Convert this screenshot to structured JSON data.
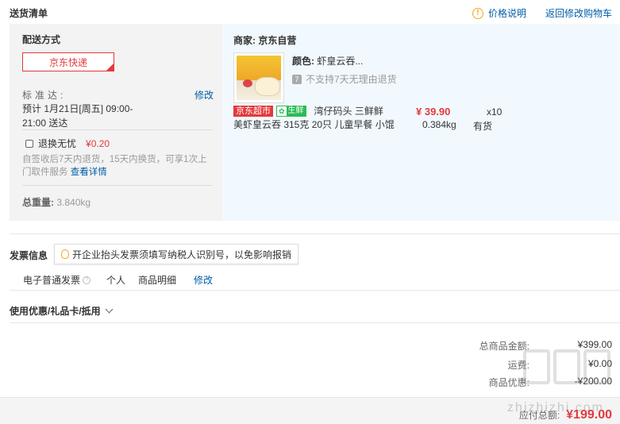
{
  "header": {
    "title": "送货清单",
    "price_note": "价格说明",
    "price_note_icon": "warning-icon",
    "back_to_cart": "返回修改购物车"
  },
  "delivery": {
    "label": "配送方式",
    "express": "京东快递",
    "standard_label": "标准达:",
    "modify": "修改",
    "estimate": "预计 1月21日[周五] 09:00-21:00 送达",
    "exchange_label": "退换无忧",
    "exchange_price": "¥0.20",
    "exchange_desc": "自签收后7天内退货，15天内换货，可享1次上门取件服务",
    "exchange_detail_link": "查看详情",
    "weight_label": "总重量:",
    "weight_value": "3.840kg"
  },
  "item": {
    "seller": "商家: 京东自营",
    "color_label": "颜色:",
    "color_value": "虾皇云吞...",
    "no_return": "不支持7天无理由退货",
    "badge_jd": "京东超市",
    "badge_fresh": "生鲜",
    "title_line1": "湾仔码头 三鲜鲜",
    "title_line2": "美虾皇云吞 315克 20只 儿童早餐 小馄",
    "price": "¥ 39.90",
    "qty": "x10",
    "weight": "0.384kg",
    "stock": "有货"
  },
  "invoice": {
    "label": "发票信息",
    "tip": "开企业抬头发票须填写纳税人识别号，以免影响报销",
    "type": "电子普通发票",
    "title": "个人",
    "content": "商品明细",
    "modify": "修改"
  },
  "coupon": {
    "label": "使用优惠/礼品卡/抵用"
  },
  "summary": {
    "total_label": "总商品金额:",
    "total_value": "¥399.00",
    "shipping_label": "运费:",
    "shipping_value": "¥0.00",
    "discount_label": "商品优惠:",
    "discount_value": "-¥200.00",
    "payable_label": "应付总额:",
    "payable_value": "¥199.00"
  },
  "watermark": "zhizhizhi.com"
}
